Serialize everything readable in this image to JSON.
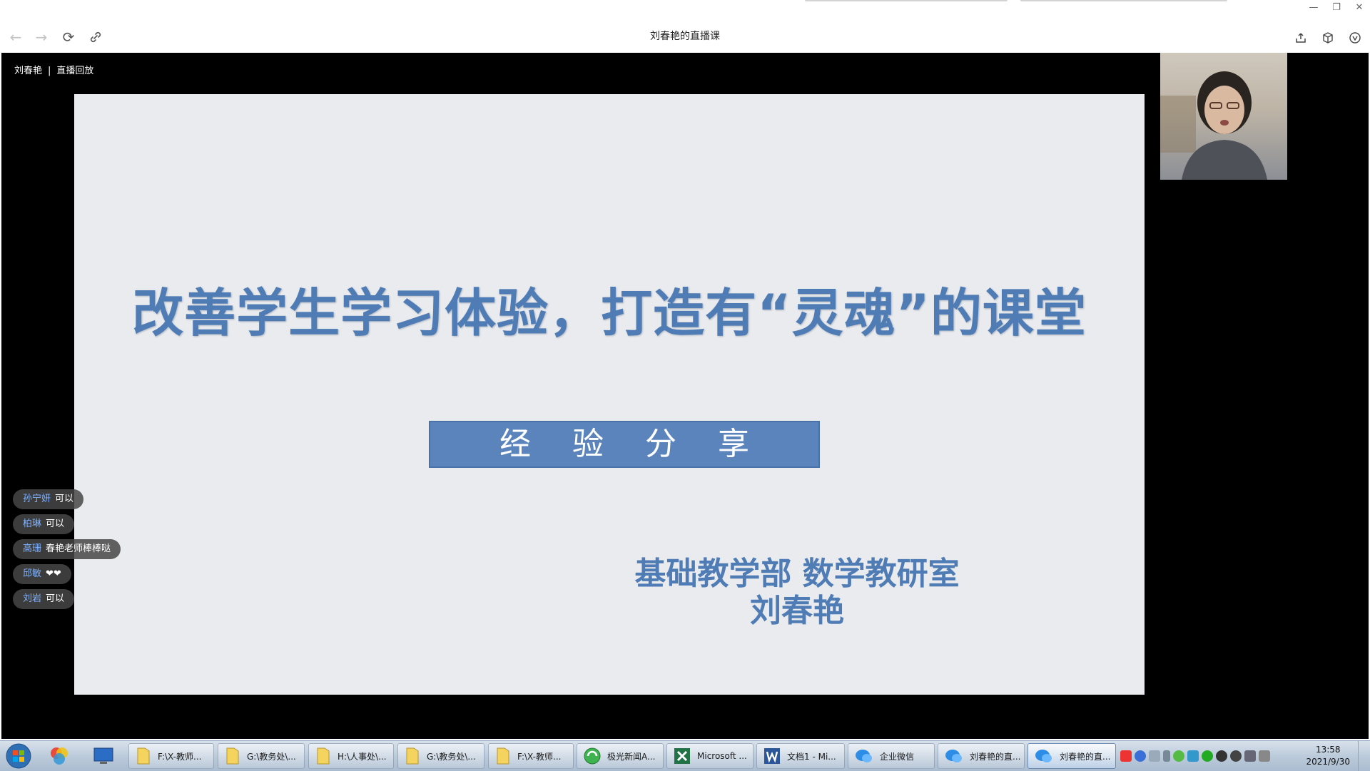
{
  "window": {
    "title": "刘春艳的直播课",
    "controls": {
      "minimize": "—",
      "restore": "❐",
      "close": "✕"
    },
    "nav": {
      "back": "←",
      "forward": "→",
      "refresh": "⟳"
    }
  },
  "stream": {
    "host": "刘春艳",
    "separator": "|",
    "mode": "直播回放"
  },
  "slide": {
    "title": "改善学生学习体验，打造有“灵魂”的课堂",
    "badge": "经验分享",
    "department": "基础教学部 数学教研室",
    "author": "刘春艳"
  },
  "danmaku": [
    {
      "name": "孙宁妍",
      "message": "可以"
    },
    {
      "name": "柏琳",
      "message": "可以"
    },
    {
      "name": "高珊",
      "message": "春艳老师棒棒哒"
    },
    {
      "name": "邱敏",
      "message": "❤❤"
    },
    {
      "name": "刘岩",
      "message": "可以"
    }
  ],
  "taskbar": {
    "items": [
      {
        "label": "F:\\X-教师...",
        "icon": "folder-icon"
      },
      {
        "label": "G:\\教务处\\...",
        "icon": "folder-icon"
      },
      {
        "label": "H:\\人事处\\...",
        "icon": "folder-icon"
      },
      {
        "label": "G:\\教务处\\...",
        "icon": "folder-icon"
      },
      {
        "label": "F:\\X-教师...",
        "icon": "folder-icon"
      },
      {
        "label": "极光新闻A...",
        "icon": "browser-icon"
      },
      {
        "label": "Microsoft ...",
        "icon": "excel-icon"
      },
      {
        "label": "文档1 - Mi...",
        "icon": "word-icon"
      },
      {
        "label": "企业微信",
        "icon": "wecom-icon"
      },
      {
        "label": "刘春艳的直...",
        "icon": "wecom-icon"
      },
      {
        "label": "刘春艳的直...",
        "icon": "wecom-icon"
      }
    ],
    "clock": {
      "time": "13:58",
      "date": "2021/9/30"
    }
  },
  "colors": {
    "accent": "#4f7cb5",
    "danmaku_name": "#7fb2ff"
  }
}
